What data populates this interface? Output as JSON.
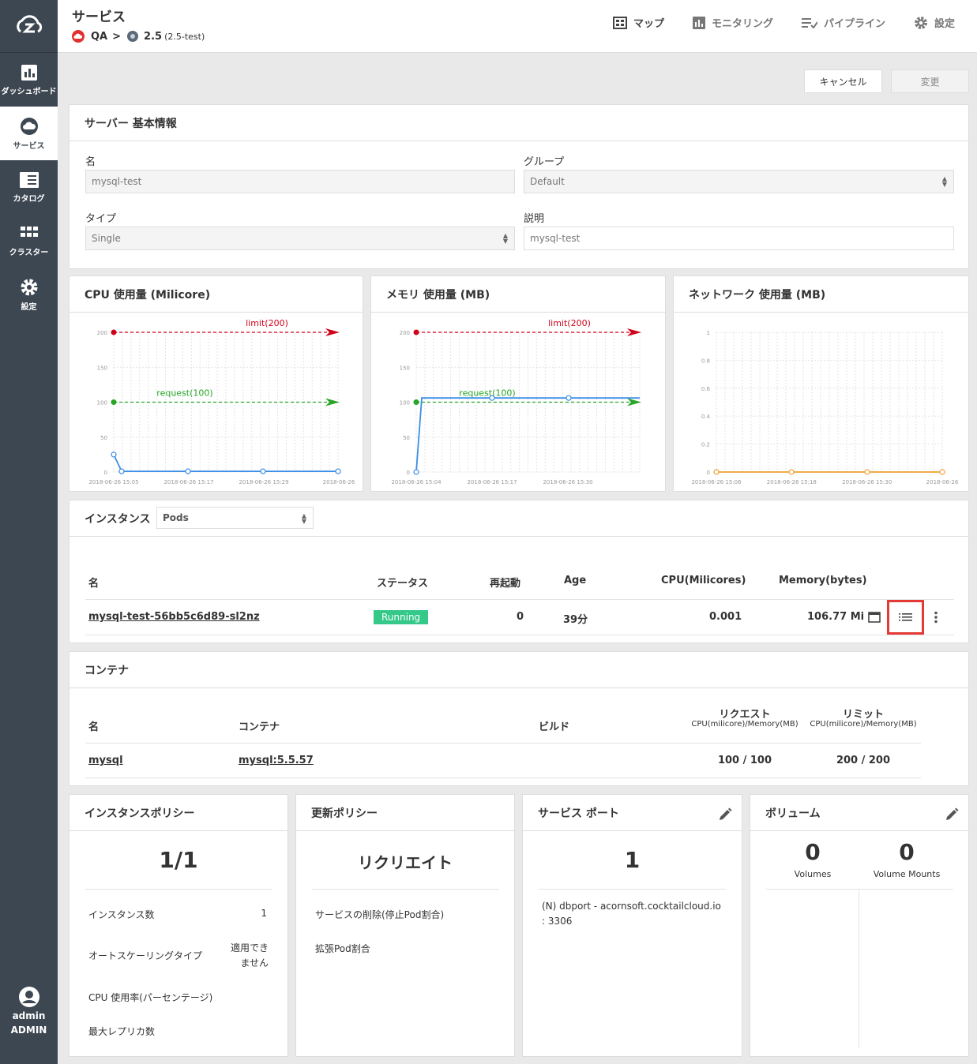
{
  "sidebar": {
    "items": [
      {
        "label": "ダッシュボード",
        "icon": "dashboard-icon"
      },
      {
        "label": "サービス",
        "icon": "cloud-icon",
        "active": true
      },
      {
        "label": "カタログ",
        "icon": "catalog-icon"
      },
      {
        "label": "クラスター",
        "icon": "grid-icon"
      },
      {
        "label": "設定",
        "icon": "gear-icon"
      }
    ],
    "user": {
      "name": "admin",
      "role": "ADMIN"
    }
  },
  "header": {
    "title": "サービス",
    "breadcrumb": {
      "root": "QA",
      "sep": ">",
      "version": "2.5",
      "version_detail": "(2.5-test)"
    },
    "nav": [
      {
        "label": "マップ",
        "icon": "map-icon"
      },
      {
        "label": "モニタリング",
        "icon": "monitoring-icon"
      },
      {
        "label": "パイプライン",
        "icon": "pipeline-icon"
      },
      {
        "label": "設定",
        "icon": "gear-icon"
      }
    ]
  },
  "actions": {
    "cancel": "キャンセル",
    "change": "変更"
  },
  "server_info": {
    "title": "サーバー 基本情報",
    "name_label": "名",
    "name_value": "mysql-test",
    "group_label": "グループ",
    "group_value": "Default",
    "type_label": "タイプ",
    "type_value": "Single",
    "desc_label": "説明",
    "desc_value": "mysql-test"
  },
  "chart_data": [
    {
      "type": "line",
      "title": "CPU 使用量 (Milicore)",
      "y_ticks": [
        "200",
        "150",
        "100",
        "50",
        "0"
      ],
      "ylim": [
        0,
        200
      ],
      "x_ticks": [
        "2018-06-26 15:05",
        "2018-06-26 15:17",
        "2018-06-26 15:29",
        "2018-06-26"
      ],
      "limit_label": "limit(200)",
      "limit": 200,
      "request_label": "request(100)",
      "request": 100,
      "series": [
        {
          "values": [
            25,
            1,
            1,
            1,
            1
          ]
        }
      ],
      "colors": {
        "usage": "#3a8ee6",
        "limit": "#d0021b",
        "request": "#27a527"
      }
    },
    {
      "type": "line",
      "title": "メモリ 使用量 (MB)",
      "y_ticks": [
        "200",
        "150",
        "100",
        "50",
        "0"
      ],
      "ylim": [
        0,
        200
      ],
      "x_ticks": [
        "2018-06-26 15:04",
        "2018-06-26 15:17",
        "2018-06-26 15:30"
      ],
      "limit_label": "limit(200)",
      "limit": 200,
      "request_label": "request(100)",
      "request": 100,
      "series": [
        {
          "values": [
            0,
            106,
            106,
            106,
            106
          ]
        }
      ],
      "colors": {
        "usage": "#3a8ee6",
        "limit": "#d0021b",
        "request": "#27a527"
      }
    },
    {
      "type": "line",
      "title": "ネットワーク 使用量 (MB)",
      "y_ticks": [
        "1",
        "0.8",
        "0.6",
        "0.4",
        "0.2",
        "0"
      ],
      "ylim": [
        0,
        1
      ],
      "x_ticks": [
        "2018-06-26 15:06",
        "2018-06-26 15:18",
        "2018-06-26 15:30",
        "2018-06-26"
      ],
      "series": [
        {
          "values": [
            0,
            0,
            0,
            0,
            0
          ]
        }
      ],
      "colors": {
        "usage": "#f0a030"
      }
    }
  ],
  "instances": {
    "title": "インスタンス",
    "select_value": "Pods",
    "headers": [
      "名",
      "ステータス",
      "再起動",
      "Age",
      "CPU(Milicores)",
      "Memory(bytes)"
    ],
    "row": {
      "name": "mysql-test-56bb5c6d89-sl2nz",
      "status": "Running",
      "restarts": "0",
      "age": "39分",
      "cpu": "0.001",
      "memory": "106.77 Mi"
    }
  },
  "containers": {
    "title": "コンテナ",
    "headers": {
      "name": "名",
      "container": "コンテナ",
      "build": "ビルド",
      "request": "リクエスト",
      "request_sub": "CPU(milicore)/Memory(MB)",
      "limit": "リミット",
      "limit_sub": "CPU(milicore)/Memory(MB)"
    },
    "row": {
      "name": "mysql",
      "container": "mysql:5.5.57",
      "request": "100 / 100",
      "limit": "200 / 200"
    }
  },
  "instance_policy": {
    "title": "インスタンスポリシー",
    "value": "1/1",
    "rows": [
      {
        "label": "インスタンス数",
        "value": "1"
      },
      {
        "label": "オートスケーリングタイプ",
        "value": "適用でき\nません"
      },
      {
        "label": "CPU 使用率(パーセンテージ)",
        "value": ""
      },
      {
        "label": "最大レプリカ数",
        "value": ""
      }
    ]
  },
  "update_policy": {
    "title": "更新ポリシー",
    "value": "リクリエイト",
    "rows": [
      "サービスの削除(停止Pod割合)",
      "拡張Pod割合"
    ]
  },
  "service_port": {
    "title": "サービス ポート",
    "value": "1",
    "line1": "(N) dbport - acornsoft.cocktailcloud.io",
    "line2": ": 3306"
  },
  "volumes": {
    "title": "ボリューム",
    "volumes": "0",
    "volumes_label": "Volumes",
    "mounts": "0",
    "mounts_label": "Volume Mounts"
  }
}
